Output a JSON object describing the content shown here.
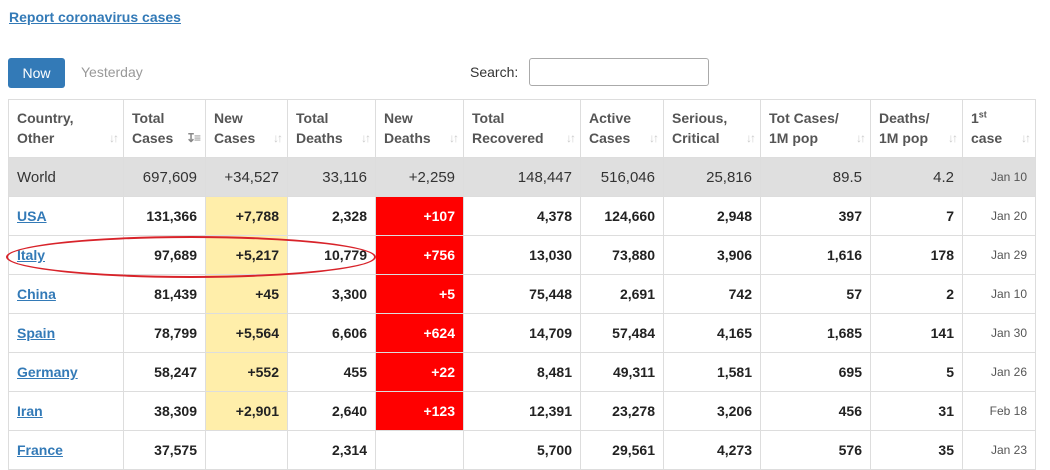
{
  "report_link": "Report coronavirus cases",
  "tabs": {
    "now": "Now",
    "yesterday": "Yesterday"
  },
  "search": {
    "label": "Search:",
    "value": ""
  },
  "columns": [
    {
      "l1": "Country,",
      "l2": "Other",
      "sup": ""
    },
    {
      "l1": "Total",
      "l2": "Cases",
      "sup": ""
    },
    {
      "l1": "New",
      "l2": "Cases",
      "sup": ""
    },
    {
      "l1": "Total",
      "l2": "Deaths",
      "sup": ""
    },
    {
      "l1": "New",
      "l2": "Deaths",
      "sup": ""
    },
    {
      "l1": "Total",
      "l2": "Recovered",
      "sup": ""
    },
    {
      "l1": "Active",
      "l2": "Cases",
      "sup": ""
    },
    {
      "l1": "Serious,",
      "l2": "Critical",
      "sup": ""
    },
    {
      "l1": "Tot Cases/",
      "l2": "1M pop",
      "sup": ""
    },
    {
      "l1": "Deaths/",
      "l2": "1M pop",
      "sup": ""
    },
    {
      "l1": "1",
      "l2": "case",
      "sup": "st"
    }
  ],
  "world": {
    "country": "World",
    "total_cases": "697,609",
    "new_cases": "+34,527",
    "total_deaths": "33,116",
    "new_deaths": "+2,259",
    "total_recovered": "148,447",
    "active_cases": "516,046",
    "serious": "25,816",
    "cases_per_1m": "89.5",
    "deaths_per_1m": "4.2",
    "first_case": "Jan 10"
  },
  "rows": [
    {
      "country": "USA",
      "total_cases": "131,366",
      "new_cases": "+7,788",
      "total_deaths": "2,328",
      "new_deaths": "+107",
      "total_recovered": "4,378",
      "active_cases": "124,660",
      "serious": "2,948",
      "cases_per_1m": "397",
      "deaths_per_1m": "7",
      "first_case": "Jan 20"
    },
    {
      "country": "Italy",
      "total_cases": "97,689",
      "new_cases": "+5,217",
      "total_deaths": "10,779",
      "new_deaths": "+756",
      "total_recovered": "13,030",
      "active_cases": "73,880",
      "serious": "3,906",
      "cases_per_1m": "1,616",
      "deaths_per_1m": "178",
      "first_case": "Jan 29"
    },
    {
      "country": "China",
      "total_cases": "81,439",
      "new_cases": "+45",
      "total_deaths": "3,300",
      "new_deaths": "+5",
      "total_recovered": "75,448",
      "active_cases": "2,691",
      "serious": "742",
      "cases_per_1m": "57",
      "deaths_per_1m": "2",
      "first_case": "Jan 10"
    },
    {
      "country": "Spain",
      "total_cases": "78,799",
      "new_cases": "+5,564",
      "total_deaths": "6,606",
      "new_deaths": "+624",
      "total_recovered": "14,709",
      "active_cases": "57,484",
      "serious": "4,165",
      "cases_per_1m": "1,685",
      "deaths_per_1m": "141",
      "first_case": "Jan 30"
    },
    {
      "country": "Germany",
      "total_cases": "58,247",
      "new_cases": "+552",
      "total_deaths": "455",
      "new_deaths": "+22",
      "total_recovered": "8,481",
      "active_cases": "49,311",
      "serious": "1,581",
      "cases_per_1m": "695",
      "deaths_per_1m": "5",
      "first_case": "Jan 26"
    },
    {
      "country": "Iran",
      "total_cases": "38,309",
      "new_cases": "+2,901",
      "total_deaths": "2,640",
      "new_deaths": "+123",
      "total_recovered": "12,391",
      "active_cases": "23,278",
      "serious": "3,206",
      "cases_per_1m": "456",
      "deaths_per_1m": "31",
      "first_case": "Feb 18"
    },
    {
      "country": "France",
      "total_cases": "37,575",
      "new_cases": "",
      "total_deaths": "2,314",
      "new_deaths": "",
      "total_recovered": "5,700",
      "active_cases": "29,561",
      "serious": "4,273",
      "cases_per_1m": "576",
      "deaths_per_1m": "35",
      "first_case": "Jan 23"
    }
  ],
  "colors": {
    "link": "#337ab7",
    "new_cases_highlight": "#ffeeaa",
    "new_deaths_highlight": "#ff0000",
    "world_row_bg": "#dfdfdf",
    "annotation_circle": "#d8232a"
  },
  "icons": {
    "sort_active": "sort-desc-icon",
    "sort": "sort-arrows-icon"
  }
}
